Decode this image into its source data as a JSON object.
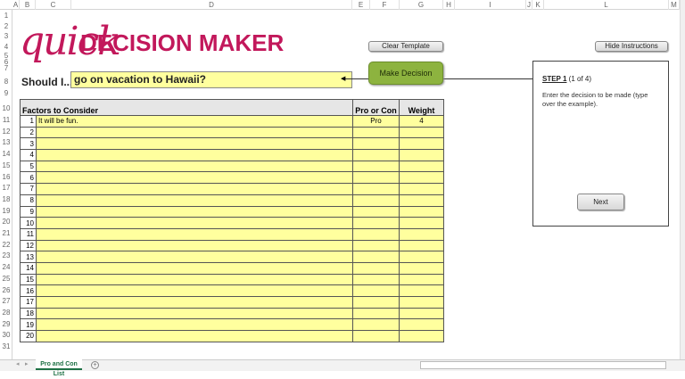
{
  "columns": [
    "A",
    "B",
    "C",
    "D",
    "E",
    "F",
    "G",
    "H",
    "I",
    "J",
    "K",
    "L",
    "M"
  ],
  "rows": [
    "1",
    "2",
    "3",
    "4",
    "5",
    "6",
    "7",
    "8",
    "9",
    "10",
    "11",
    "12",
    "13",
    "14",
    "15",
    "16",
    "17",
    "18",
    "19",
    "20",
    "21",
    "22",
    "23",
    "24",
    "25",
    "26",
    "27",
    "28",
    "29",
    "30",
    "31"
  ],
  "logo": {
    "script": "quick",
    "title": "DECISION MAKER"
  },
  "should_label": "Should I...",
  "decision_value": "go on vacation to Hawaii?",
  "buttons": {
    "clear": "Clear Template",
    "hide": "Hide Instructions",
    "make": "Make Decision",
    "next": "Next"
  },
  "table": {
    "headers": [
      "Factors to Consider",
      "Pro or Con",
      "Weight"
    ],
    "rows": [
      {
        "n": "1",
        "factor": "It will be fun.",
        "procon": "Pro",
        "weight": "4"
      },
      {
        "n": "2"
      },
      {
        "n": "3"
      },
      {
        "n": "4"
      },
      {
        "n": "5"
      },
      {
        "n": "6"
      },
      {
        "n": "7"
      },
      {
        "n": "8"
      },
      {
        "n": "9"
      },
      {
        "n": "10"
      },
      {
        "n": "11"
      },
      {
        "n": "12"
      },
      {
        "n": "13"
      },
      {
        "n": "14"
      },
      {
        "n": "15"
      },
      {
        "n": "16"
      },
      {
        "n": "17"
      },
      {
        "n": "18"
      },
      {
        "n": "19"
      },
      {
        "n": "20"
      }
    ]
  },
  "instructions": {
    "step": "STEP 1",
    "progress": "(1 of 4)",
    "text": "Enter the decision to be made (type over the example)."
  },
  "sheet_tab": "Pro and Con List",
  "colors": {
    "brand": "#c2185b",
    "input": "#ffff9e",
    "button_green": "#8db33f"
  }
}
